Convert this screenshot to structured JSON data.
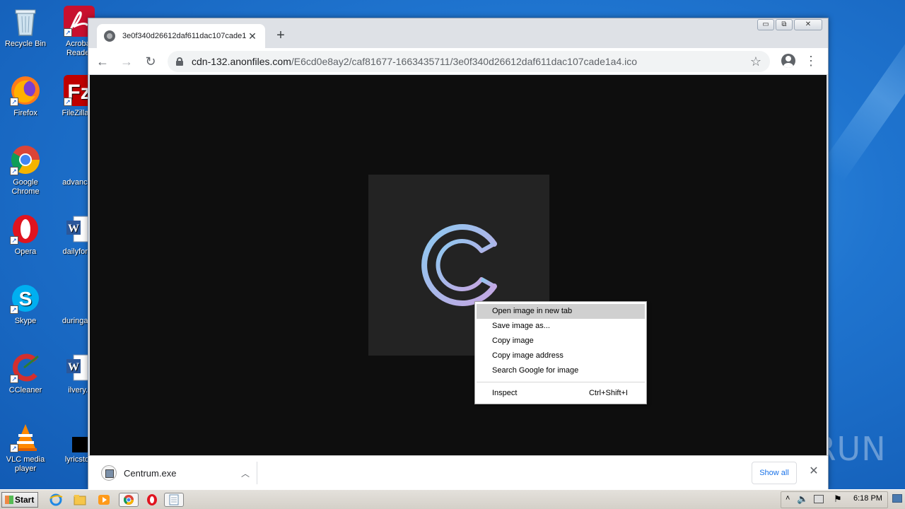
{
  "desktop": {
    "icons": [
      {
        "label": "Recycle Bin"
      },
      {
        "label": "Acrobat Reader"
      },
      {
        "label": "Firefox"
      },
      {
        "label": "FileZilla C"
      },
      {
        "label": "Google Chrome"
      },
      {
        "label": "advanced"
      },
      {
        "label": "Opera"
      },
      {
        "label": "dailyforce"
      },
      {
        "label": "Skype"
      },
      {
        "label": "duringany"
      },
      {
        "label": "CCleaner"
      },
      {
        "label": "ilvery.r"
      },
      {
        "label": "VLC media player"
      },
      {
        "label": "lyricstoo"
      }
    ]
  },
  "browser": {
    "tab_title": "3e0f340d26612daf611dac107cade1",
    "url_host": "cdn-132.anonfiles.com",
    "url_path": "/E6cd0e8ay2/caf81677-1663435711/3e0f340d26612daf611dac107cade1a4.ico",
    "window_controls": {
      "minimize": "▭",
      "restore": "⧉",
      "close": "✕"
    }
  },
  "context_menu": {
    "items": [
      {
        "label": "Open image in new tab",
        "shortcut": ""
      },
      {
        "label": "Save image as...",
        "shortcut": ""
      },
      {
        "label": "Copy image",
        "shortcut": ""
      },
      {
        "label": "Copy image address",
        "shortcut": ""
      },
      {
        "label": "Search Google for image",
        "shortcut": ""
      }
    ],
    "inspect": {
      "label": "Inspect",
      "shortcut": "Ctrl+Shift+I"
    }
  },
  "download_bar": {
    "file_name": "Centrum.exe",
    "show_all": "Show all"
  },
  "watermark": "ANY RUN",
  "taskbar": {
    "start_label": "Start",
    "clock": "6:18 PM"
  },
  "colors": {
    "desktop_bg": "#1f74cf",
    "logo_gradient_start": "#9ad0f0",
    "logo_gradient_end": "#c7a8e0",
    "link_blue": "#1a73e8"
  }
}
